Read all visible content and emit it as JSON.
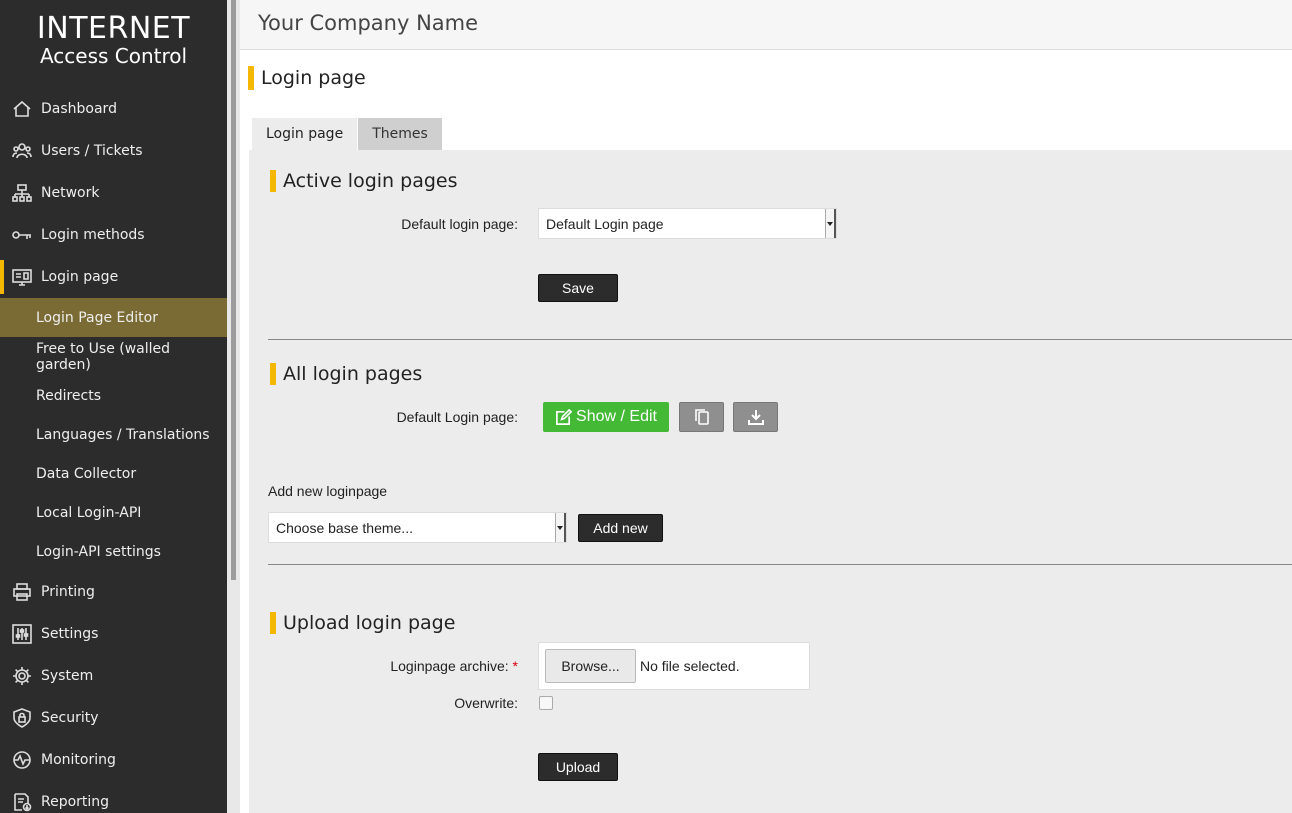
{
  "brand": {
    "line1": "INTERNET",
    "line2": "Access Control"
  },
  "sidebar": {
    "items": [
      {
        "label": "Dashboard",
        "icon": "home-icon"
      },
      {
        "label": "Users / Tickets",
        "icon": "users-icon"
      },
      {
        "label": "Network",
        "icon": "network-icon"
      },
      {
        "label": "Login methods",
        "icon": "key-icon"
      },
      {
        "label": "Login page",
        "icon": "monitor-icon"
      }
    ],
    "subitems": [
      {
        "label": "Login Page Editor"
      },
      {
        "label": "Free to Use (walled garden)"
      },
      {
        "label": "Redirects"
      },
      {
        "label": "Languages / Translations"
      },
      {
        "label": "Data Collector"
      },
      {
        "label": "Local Login-API"
      },
      {
        "label": "Login-API settings"
      }
    ],
    "items_after": [
      {
        "label": "Printing",
        "icon": "printer-icon"
      },
      {
        "label": "Settings",
        "icon": "sliders-icon"
      },
      {
        "label": "System",
        "icon": "gear-icon"
      },
      {
        "label": "Security",
        "icon": "shield-lock-icon"
      },
      {
        "label": "Monitoring",
        "icon": "pulse-icon"
      },
      {
        "label": "Reporting",
        "icon": "report-icon"
      }
    ]
  },
  "header": {
    "company": "Your Company Name"
  },
  "page": {
    "title": "Login page"
  },
  "tabs": [
    {
      "label": "Login page"
    },
    {
      "label": "Themes"
    }
  ],
  "active_section": {
    "title": "Active login pages",
    "default_label": "Default login page:",
    "default_value": "Default Login page",
    "save_label": "Save"
  },
  "all_section": {
    "title": "All login pages",
    "row_label": "Default Login page:",
    "show_edit_label": "Show / Edit",
    "add_new_title": "Add new loginpage",
    "theme_placeholder": "Choose base theme...",
    "add_new_label": "Add new"
  },
  "upload_section": {
    "title": "Upload login page",
    "archive_label": "Loginpage archive:",
    "required_mark": "*",
    "browse_label": "Browse...",
    "file_status": "No file selected.",
    "overwrite_label": "Overwrite:",
    "upload_label": "Upload"
  },
  "colors": {
    "sidebar_bg": "#2c2c2c",
    "accent": "#f5b800",
    "selected_sub": "#7a6a33",
    "green": "#43b936"
  }
}
